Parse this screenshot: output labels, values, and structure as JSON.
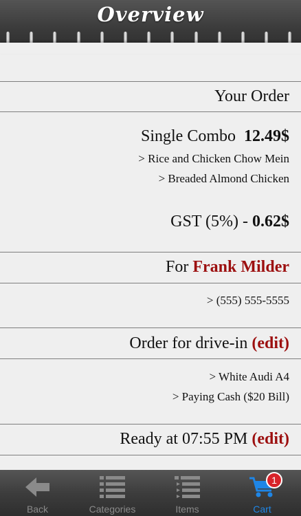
{
  "header": {
    "title": "Overview"
  },
  "order": {
    "heading": "Your Order",
    "item_name": "Single Combo",
    "item_price": "12.49$",
    "item_details": [
      "> Rice and Chicken Chow Mein",
      "> Breaded Almond Chicken"
    ],
    "tax_label": "GST (5%) -",
    "tax_value": "0.62$"
  },
  "customer": {
    "for_label": "For",
    "name": "Frank Milder",
    "phone": "> (555) 555-5555"
  },
  "drive_in": {
    "label": "Order for drive-in",
    "edit_label": "(edit)",
    "details": [
      "> White Audi A4",
      "> Paying Cash ($20 Bill)"
    ]
  },
  "ready": {
    "label": "Ready at 07:55 PM",
    "edit_label": "(edit)"
  },
  "tabbar": {
    "back_label": "Back",
    "categories_label": "Categories",
    "items_label": "Items",
    "cart_label": "Cart",
    "cart_badge": "1"
  },
  "colors": {
    "accent_red": "#9c0f0f",
    "active_tab": "#1f86e6",
    "badge": "#d8232a"
  }
}
